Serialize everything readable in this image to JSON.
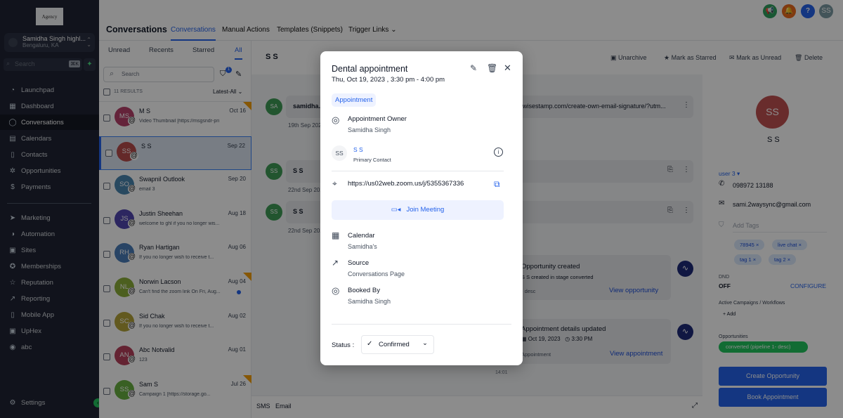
{
  "sidebar": {
    "logo": "Agency",
    "account_name": "Samidha Singh highl...",
    "account_location": "Bengaluru, KA",
    "search_placeholder": "Search",
    "search_shortcut": "⌘K",
    "items": [
      {
        "label": "Launchpad",
        "icon": "rocket"
      },
      {
        "label": "Dashboard",
        "icon": "grid"
      },
      {
        "label": "Conversations",
        "icon": "chat"
      },
      {
        "label": "Calendars",
        "icon": "calendar"
      },
      {
        "label": "Contacts",
        "icon": "contact-book"
      },
      {
        "label": "Opportunities",
        "icon": "network"
      },
      {
        "label": "Payments",
        "icon": "dollar"
      }
    ],
    "items2": [
      {
        "label": "Marketing",
        "icon": "send"
      },
      {
        "label": "Automation",
        "icon": "automation"
      },
      {
        "label": "Sites",
        "icon": "browser"
      },
      {
        "label": "Memberships",
        "icon": "badge"
      },
      {
        "label": "Reputation",
        "icon": "star"
      },
      {
        "label": "Reporting",
        "icon": "trend"
      },
      {
        "label": "Mobile App",
        "icon": "phone"
      },
      {
        "label": "UpHex",
        "icon": "uphex"
      },
      {
        "label": "abc",
        "icon": "globe"
      }
    ],
    "settings": "Settings"
  },
  "header": {
    "title": "Conversations",
    "tabs": [
      "Conversations",
      "Manual Actions",
      "Templates (Snippets)",
      "Trigger Links"
    ],
    "avatar": "SS",
    "help": "?"
  },
  "list": {
    "subtabs": [
      "Unread",
      "Recents",
      "Starred",
      "All"
    ],
    "search_placeholder": "Search",
    "filter_count": "1",
    "results": "11 RESULTS",
    "sort": "Latest-All",
    "rows": [
      {
        "initials": "MS",
        "name": "M S",
        "date": "Oct 16",
        "preview": "Video Thumbnail [https://msgsndr-pri",
        "color": "#b7416b",
        "flag": true
      },
      {
        "initials": "SS",
        "name": "S S",
        "date": "Sep 22",
        "preview": "",
        "color": "#b74b4b",
        "selected": true
      },
      {
        "initials": "SO",
        "name": "Swapnil Outlook",
        "date": "Sep 20",
        "preview": "email 3",
        "color": "#4a86b0"
      },
      {
        "initials": "JS",
        "name": "Justin Sheehan",
        "date": "Aug 18",
        "preview": "welcome to ghl if you no longer wis...",
        "color": "#5046b0"
      },
      {
        "initials": "RH",
        "name": "Ryan Hartigan",
        "date": "Aug 06",
        "preview": "If you no longer wish to receive t...",
        "color": "#4a7cb8"
      },
      {
        "initials": "NL",
        "name": "Norwin Lacson",
        "date": "Aug 04",
        "preview": "Can't find the zoom link On Fri, Aug...",
        "color": "#8aad3a",
        "flag": true,
        "unread": true
      },
      {
        "initials": "SC",
        "name": "Sid Chak",
        "date": "Aug 02",
        "preview": "If you no longer wish to receive t...",
        "color": "#b3a23a"
      },
      {
        "initials": "AN",
        "name": "Abc Notvalid",
        "date": "Aug 01",
        "preview": "123",
        "color": "#b7415b"
      },
      {
        "initials": "SS",
        "name": "Sam S",
        "date": "Jul 26",
        "preview": "Campaign 1    [https://storage.go...",
        "color": "#68b040",
        "flag": true
      }
    ]
  },
  "chat": {
    "contact": "S S",
    "actions": [
      "Unarchive",
      "Mark as Starred",
      "Mark as Unread",
      "Delete"
    ],
    "messages": [
      {
        "initials": "SA",
        "sender": "samidha.",
        "text": "wisestamp.com/create-own-email-signature/?utm...",
        "time": "19th Sep 2023"
      },
      {
        "initials": "SS",
        "sender": "S S",
        "text": "",
        "time": "22nd Sep 2023"
      },
      {
        "initials": "SS",
        "sender": "S S",
        "text": "",
        "time": "22nd Sep 2023"
      }
    ],
    "opp_card": {
      "title": "Opportunity created",
      "sub": "S S created in stage converted",
      "foot": "- desc",
      "link": "View opportunity"
    },
    "appt_card": {
      "title": "Appointment details updated",
      "date": "Oct 19, 2023",
      "time": "3:30 PM",
      "foot": "Appointment",
      "link": "View appointment"
    },
    "time": "14:01",
    "compose_tabs": [
      "SMS",
      "Email"
    ]
  },
  "contact": {
    "avatar": "SS",
    "name": "S S",
    "owner": "user 3",
    "phone": "098972 13188",
    "email": "sami.2waysync@gmail.com",
    "tags_placeholder": "Add Tags",
    "tags": [
      "78945",
      "live chat",
      "tag 1",
      "tag 2"
    ],
    "dnd_label": "DND",
    "dnd_value": "OFF",
    "configure": "CONFIGURE",
    "campaigns_label": "Active Campaigns / Workflows",
    "add": "+ Add",
    "opps_label": "Opportunities",
    "opp": "converted (pipeline 1- desc)",
    "create_opp": "Create Opportunity",
    "book_appt": "Book Appointment"
  },
  "modal": {
    "title": "Dental appointment",
    "datetime": "Thu, Oct 19, 2023 , 3:30 pm - 4:00 pm",
    "badge": "Appointment",
    "owner_label": "Appointment Owner",
    "owner": "Samidha Singh",
    "contact_initials": "SS",
    "contact_name": "S S",
    "contact_role": "Primary Contact",
    "location": "https://us02web.zoom.us/j/5355367336",
    "join": "Join Meeting",
    "calendar_label": "Calendar",
    "calendar": "Samidha's",
    "source_label": "Source",
    "source": "Conversations Page",
    "booked_label": "Booked By",
    "booked_by": "Samidha Singh",
    "status_label": "Status :",
    "status": "Confirmed"
  },
  "colors": {
    "accent": "#2563eb",
    "sidebar": "#1f2433",
    "success": "#22c55e"
  }
}
